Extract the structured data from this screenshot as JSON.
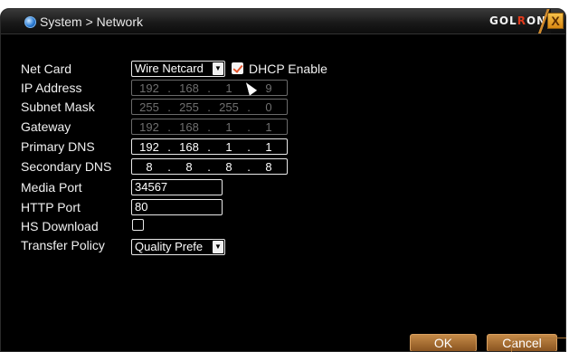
{
  "window": {
    "title": "System > Network",
    "brand_a": "GOL",
    "brand_b": "R",
    "brand_c": "ONG",
    "close_label": "X"
  },
  "form": {
    "net_card": {
      "label": "Net Card",
      "value": "Wire Netcard"
    },
    "dhcp": {
      "label": "DHCP Enable",
      "checked": true
    },
    "ip_address": {
      "label": "IP Address",
      "octets": [
        "192",
        "168",
        "1",
        "9"
      ],
      "enabled": false
    },
    "subnet_mask": {
      "label": "Subnet Mask",
      "octets": [
        "255",
        "255",
        "255",
        "0"
      ],
      "enabled": false
    },
    "gateway": {
      "label": "Gateway",
      "octets": [
        "192",
        "168",
        "1",
        "1"
      ],
      "enabled": false
    },
    "primary_dns": {
      "label": "Primary DNS",
      "octets": [
        "192",
        "168",
        "1",
        "1"
      ],
      "enabled": true
    },
    "secondary_dns": {
      "label": "Secondary DNS",
      "octets": [
        "8",
        "8",
        "8",
        "8"
      ],
      "enabled": true
    },
    "media_port": {
      "label": "Media Port",
      "value": "34567"
    },
    "http_port": {
      "label": "HTTP Port",
      "value": "80"
    },
    "hs_download": {
      "label": "HS Download",
      "checked": false
    },
    "transfer_policy": {
      "label": "Transfer Policy",
      "value": "Quality Prefe"
    }
  },
  "buttons": {
    "ok": "OK",
    "cancel": "Cancel"
  },
  "colors": {
    "accent": "#c58a48",
    "brand_red": "#e03a1c",
    "background": "#000000"
  }
}
